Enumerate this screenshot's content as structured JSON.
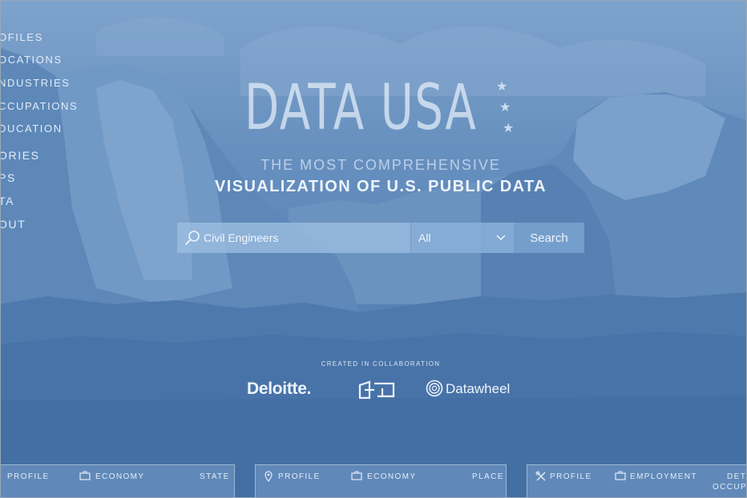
{
  "sidenav": {
    "items": [
      "OFILES",
      "OCATIONS",
      "NDUSTRIES",
      "CCUPATIONS",
      "DUCATION",
      "ORIES",
      "PS",
      "TA",
      "OUT"
    ]
  },
  "logo": {
    "text": "DATA USA"
  },
  "tagline": {
    "line1": "THE MOST COMPREHENSIVE",
    "line2": "VISUALIZATION OF U.S. PUBLIC DATA"
  },
  "search": {
    "value": "Civil Engineers",
    "filter_selected": "All",
    "button_label": "Search"
  },
  "collaboration": {
    "label": "CREATED IN COLLABORATION",
    "partners": [
      "Deloitte.",
      "Datawheel"
    ]
  },
  "cards": [
    {
      "left": "PROFILE",
      "middle": "ECONOMY",
      "right": "STATE"
    },
    {
      "left": "PROFILE",
      "middle": "ECONOMY",
      "right": "PLACE"
    },
    {
      "left": "PROFILE",
      "middle": "EMPLOYMENT",
      "right_top": "DETA",
      "right_bottom": "OCCUPA"
    }
  ],
  "colors": {
    "overlay_blue": "#5a85b7",
    "text_light": "#eef4fb"
  }
}
